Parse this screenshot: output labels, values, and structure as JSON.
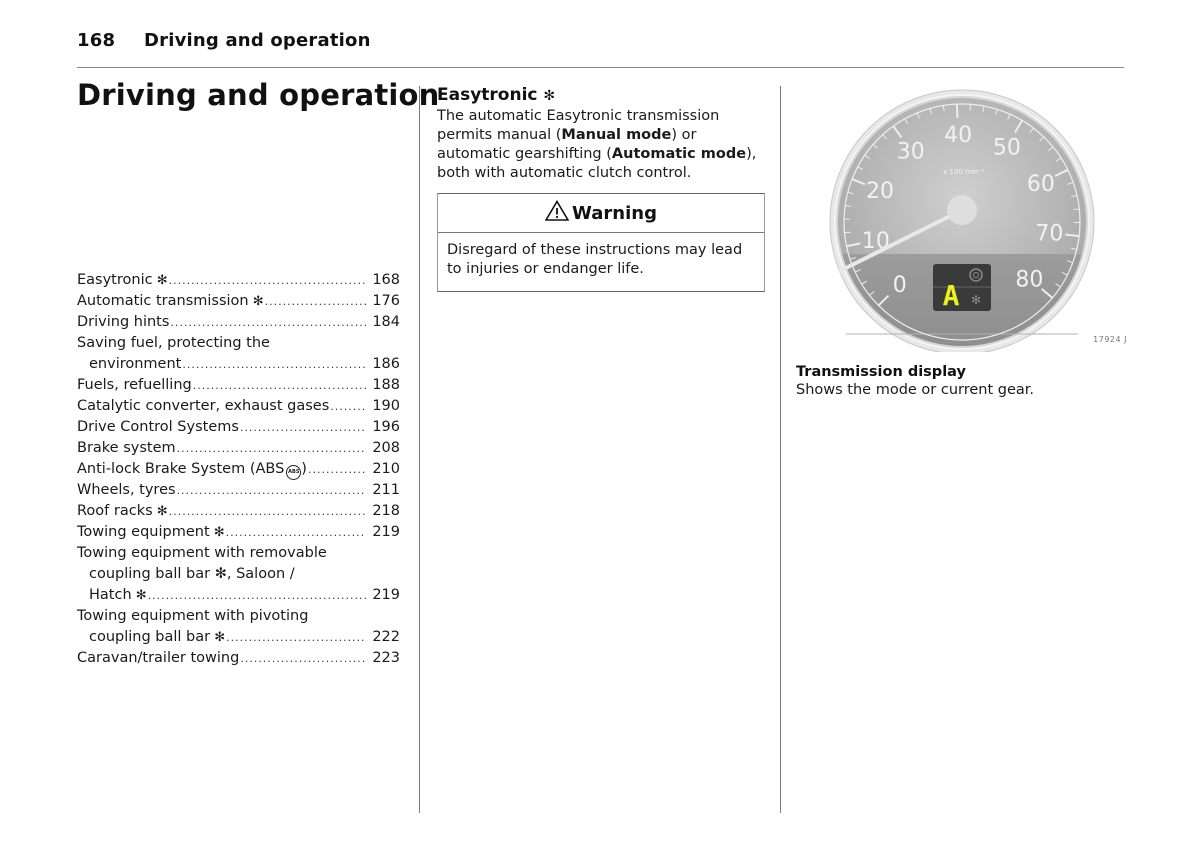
{
  "running_head": {
    "page_number": "168",
    "section": "Driving and operation"
  },
  "chapter": {
    "title": "Driving and operation"
  },
  "toc": [
    {
      "lines": [
        "Easytronic"
      ],
      "star": true,
      "page": "168"
    },
    {
      "lines": [
        "Automatic transmission"
      ],
      "star": true,
      "page": "176"
    },
    {
      "lines": [
        "Driving hints"
      ],
      "star": false,
      "page": "184"
    },
    {
      "lines": [
        "Saving fuel, protecting the",
        "environment"
      ],
      "star": false,
      "page": "186"
    },
    {
      "lines": [
        "Fuels, refuelling"
      ],
      "star": false,
      "page": "188"
    },
    {
      "lines": [
        "Catalytic converter, exhaust gases"
      ],
      "star": false,
      "page": "190"
    },
    {
      "lines": [
        "Drive Control Systems"
      ],
      "star": false,
      "page": "196"
    },
    {
      "lines": [
        "Brake system"
      ],
      "star": false,
      "page": "208"
    },
    {
      "lines": [
        "Anti-lock Brake System (ABS"
      ],
      "star": false,
      "abs_icon": true,
      "suffix": ")",
      "page": "210"
    },
    {
      "lines": [
        "Wheels, tyres"
      ],
      "star": false,
      "page": "211"
    },
    {
      "lines": [
        "Roof racks"
      ],
      "star": true,
      "page": "218"
    },
    {
      "lines": [
        "Towing equipment"
      ],
      "star": true,
      "page": "219"
    },
    {
      "lines": [
        "Towing equipment with removable",
        "coupling ball bar ✻, Saloon /",
        "Hatch"
      ],
      "star": true,
      "page": "219"
    },
    {
      "lines": [
        "Towing equipment with pivoting",
        "coupling ball bar"
      ],
      "star": true,
      "page": "222"
    },
    {
      "lines": [
        "Caravan/trailer towing"
      ],
      "star": false,
      "page": "223"
    }
  ],
  "icons": {
    "star_symbol": "✻",
    "abs_label": "ABS",
    "warning_symbol": "⚠"
  },
  "easytronic": {
    "title": "Easytronic",
    "para_1": "The automatic Easytronic transmission permits manual (",
    "manual_mode": "Manual mode",
    "para_2": ") or automatic gearshifting (",
    "automatic_mode": "Automatic mode",
    "para_3": "), both with automatic clutch control."
  },
  "warning": {
    "title": "Warning",
    "text": "Disregard of these instructions may lead to injuries or endanger life."
  },
  "figure": {
    "description": "Rev counter with transmission display",
    "dial_labels": [
      "0",
      "10",
      "20",
      "30",
      "40",
      "50",
      "60",
      "70",
      "80"
    ],
    "unit_label": "x 100 min⁻¹",
    "display_gear": "A",
    "figure_id": "17924 J",
    "display_color": "#e8f020"
  },
  "caption": {
    "title": "Transmission display",
    "text": "Shows the mode or current gear."
  }
}
